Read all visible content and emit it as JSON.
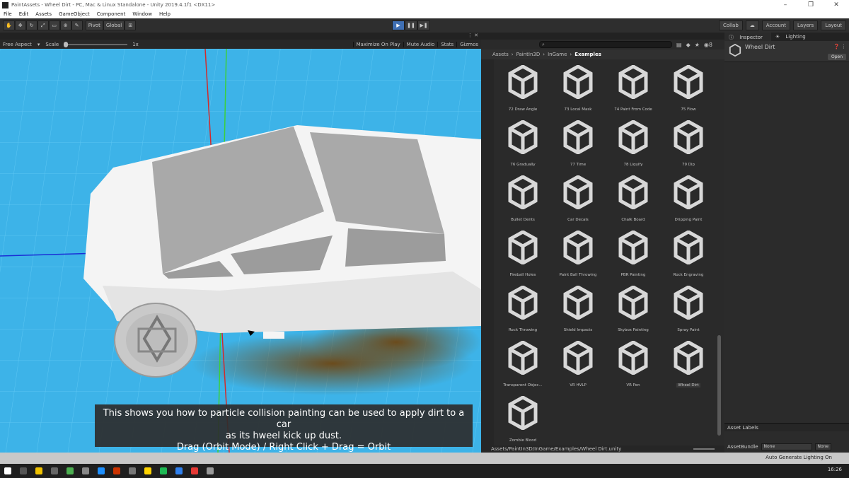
{
  "window": {
    "title": "PaintAssets - Wheel Dirt - PC, Mac & Linux Standalone - Unity 2019.4.1f1 <DX11>"
  },
  "menu": [
    "File",
    "Edit",
    "Assets",
    "GameObject",
    "Component",
    "Window",
    "Help"
  ],
  "toolbar": {
    "pivot": "Pivot",
    "global": "Global",
    "collab": "Collab",
    "account": "Account",
    "layers": "Layers",
    "layout": "Layout"
  },
  "game": {
    "aspect": "Free Aspect",
    "scale_label": "Scale",
    "scale_value": "1x",
    "maximize": "Maximize On Play",
    "mute": "Mute Audio",
    "stats": "Stats",
    "gizmos": "Gizmos",
    "caption_line1": "This shows you how to particle collision painting can be used to apply dirt to a car",
    "caption_line2": "as its hweel kick up dust.",
    "caption_line3": "Drag (Orbit Mode) / Right Click + Drag = Orbit"
  },
  "project": {
    "breadcrumb": [
      "Assets",
      "PaintIn3D",
      "InGame"
    ],
    "breadcrumb_current": "Examples",
    "assets": [
      "72 Draw Angle",
      "73 Local Mask",
      "74 Paint From Code",
      "75 Flow",
      "76    Gradually",
      "77    Time",
      "78    Liquify",
      "79 Dip",
      "Bullet Dents",
      "Car Decals",
      "Chalk Board",
      "Dripping Paint",
      "Fireball Holes",
      "Paint Ball Throwing",
      "PBR Painting",
      "Rock Engraving",
      "Rock Throwing",
      "Shield Impacts",
      "Skybox Painting",
      "Spray Paint",
      "Transparent Objec...",
      "VR HVLP",
      "VR Pen",
      "Wheel Dirt",
      "Zombie Blood"
    ],
    "selected": "Wheel Dirt",
    "footer_path": "Assets/PaintIn3D/InGame/Examples/Wheel Dirt.unity",
    "badge_count": "8"
  },
  "inspector": {
    "tab_inspector": "Inspector",
    "tab_lighting": "Lighting",
    "object_name": "Wheel Dirt",
    "open_button": "Open",
    "asset_labels": "Asset Labels",
    "asset_bundle": "AssetBundle",
    "bundle_value": "None",
    "variant_value": "None"
  },
  "status": {
    "auto_lighting": "Auto Generate Lighting On"
  },
  "taskbar": {
    "clock": "16:26"
  }
}
